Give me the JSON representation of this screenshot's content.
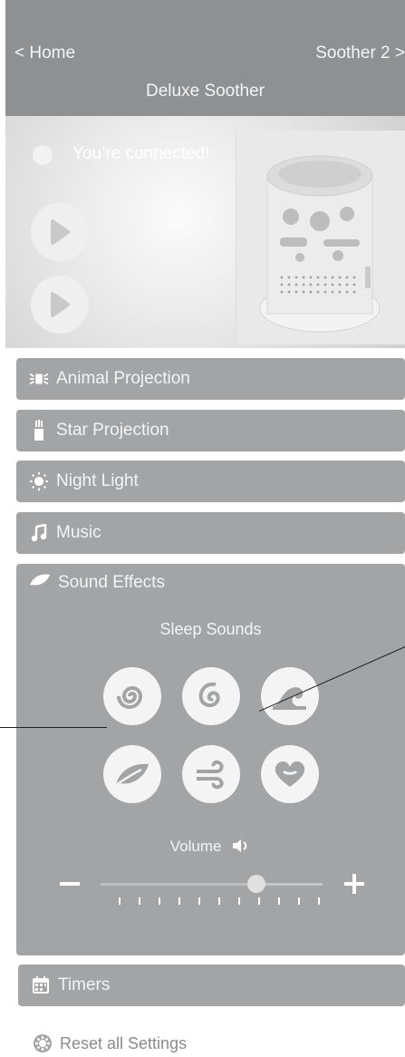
{
  "header": {
    "back_label": "< Home",
    "next_label": "Soother 2 >",
    "title": "Deluxe Soother"
  },
  "status": {
    "text": "You’re connected!"
  },
  "rows": [
    {
      "label": "Animal Projection",
      "icon": "animal-projection-icon"
    },
    {
      "label": "Star Projection",
      "icon": "star-projection-icon"
    },
    {
      "label": "Night Light",
      "icon": "night-light-icon"
    },
    {
      "label": "Music",
      "icon": "music-note-icon"
    }
  ],
  "sound_effects": {
    "label": "Sound Effects",
    "icon": "leaf-icon",
    "subtitle": "Sleep Sounds",
    "sounds": [
      {
        "icon": "spiral-icon"
      },
      {
        "icon": "swirl-icon"
      },
      {
        "icon": "wave-icon"
      },
      {
        "icon": "leaf-icon"
      },
      {
        "icon": "wind-icon"
      },
      {
        "icon": "heart-icon"
      }
    ],
    "volume_label": "Volume",
    "volume_fraction": 0.7
  },
  "timers": {
    "label": "Timers",
    "icon": "calendar-icon"
  },
  "reset": {
    "label": "Reset all Settings",
    "icon": "gear-icon"
  }
}
